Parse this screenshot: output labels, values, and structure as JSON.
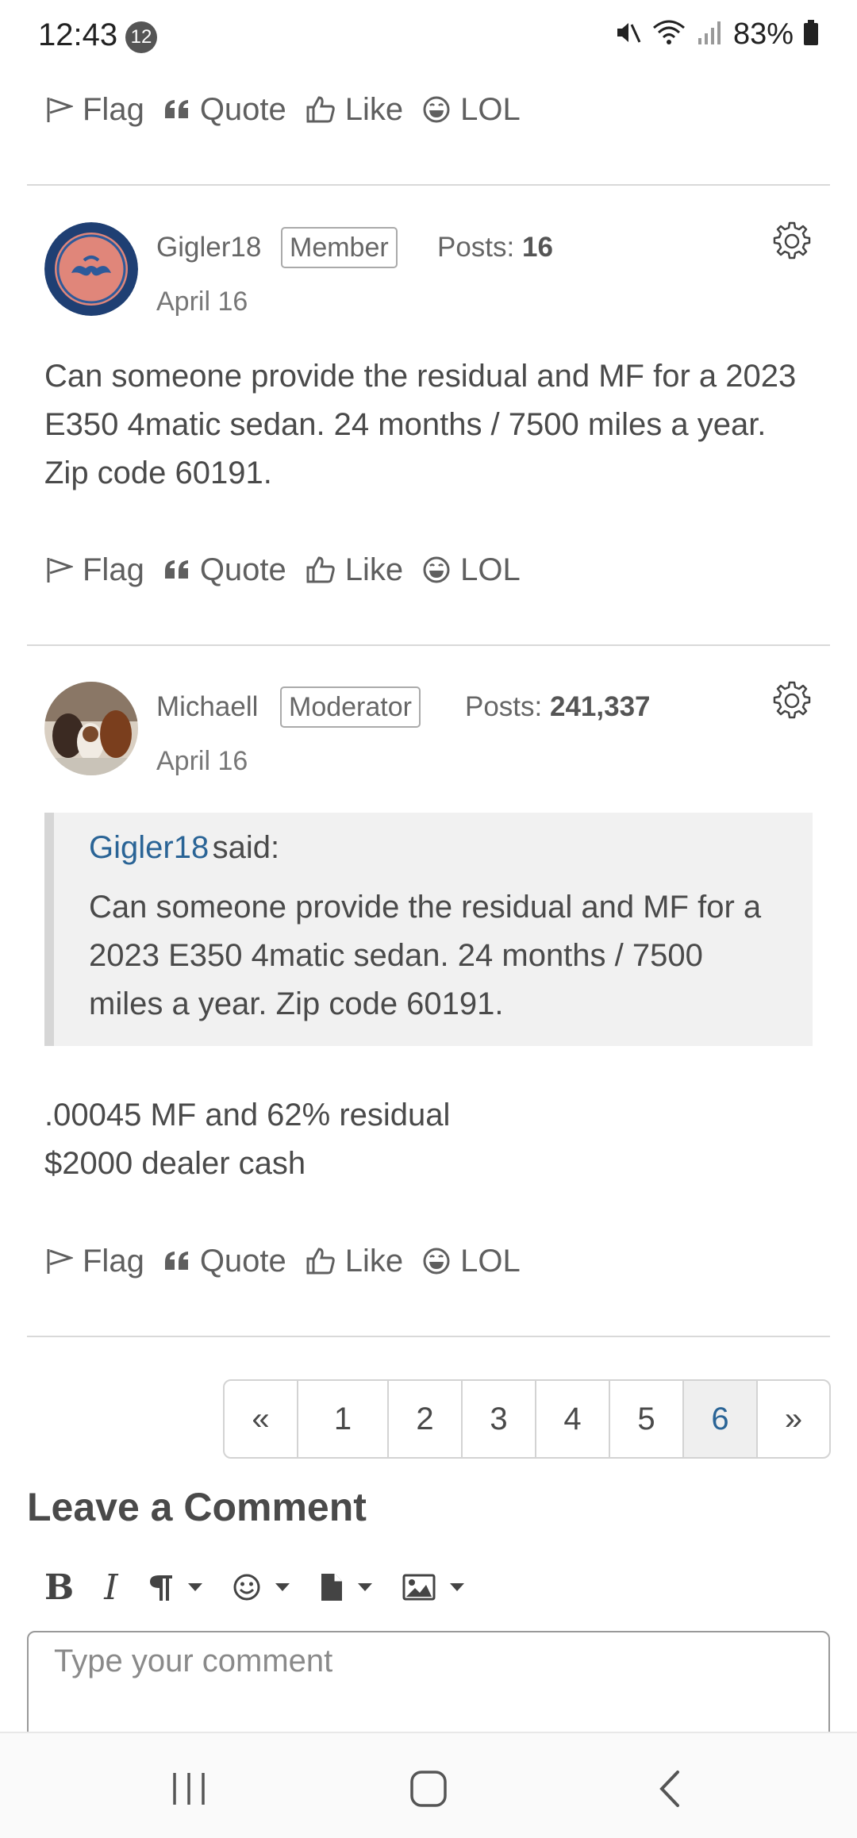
{
  "status_bar": {
    "time": "12:43",
    "notification_count": "12",
    "battery": "83%"
  },
  "actions": {
    "flag": "Flag",
    "quote": "Quote",
    "like": "Like",
    "lol": "LOL"
  },
  "posts": [
    {
      "username": "Gigler18",
      "role": "Member",
      "posts_label": "Posts:",
      "posts_count": "16",
      "date": "April 16",
      "body": "Can someone provide the residual and MF for a 2023 E350 4matic sedan. 24 months / 7500 miles a year. Zip code 60191."
    },
    {
      "username": "Michaell",
      "role": "Moderator",
      "posts_label": "Posts:",
      "posts_count": "241,337",
      "date": "April 16",
      "quote": {
        "author": "Gigler18",
        "said": "said:",
        "text": "Can someone provide the residual and MF for a 2023 E350 4matic sedan. 24 months / 7500 miles a year. Zip code 60191."
      },
      "body_line1": ".00045 MF and 62% residual",
      "body_line2": "$2000 dealer cash"
    }
  ],
  "pagination": {
    "prev": "«",
    "pages": [
      "1",
      "2",
      "3",
      "4",
      "5",
      "6"
    ],
    "current": "6",
    "next": "»"
  },
  "comment": {
    "heading": "Leave a Comment",
    "placeholder": "Type your comment",
    "bold": "B",
    "italic": "I"
  },
  "colors": {
    "link": "#2a6496",
    "avatar_ring": "#1f3f73",
    "avatar_fill": "#e0867a"
  }
}
